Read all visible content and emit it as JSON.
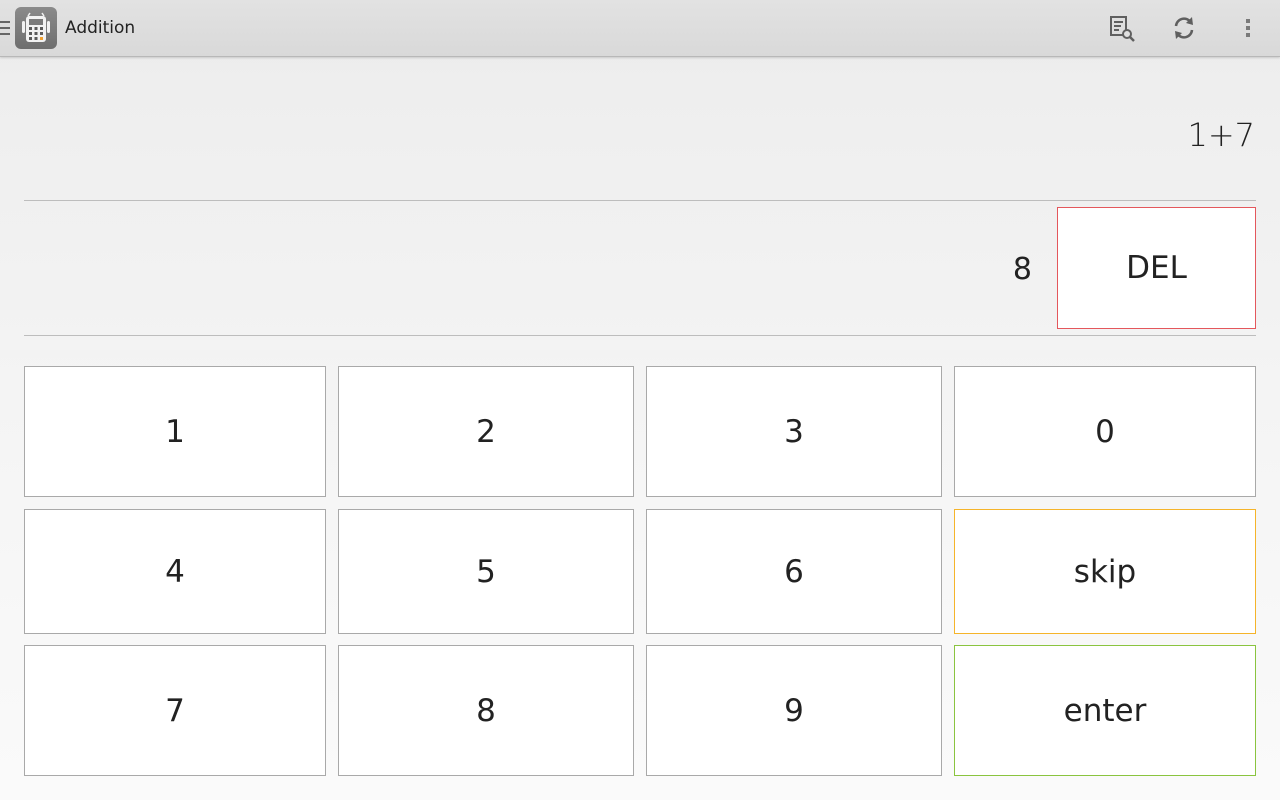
{
  "app": {
    "title": "Addition"
  },
  "actions": {
    "search_icon": "search-list-icon",
    "refresh_icon": "refresh-icon",
    "overflow_icon": "overflow-menu-icon"
  },
  "problem": {
    "expression": "1+7",
    "answer": "8"
  },
  "keypad": {
    "del": "DEL",
    "k1": "1",
    "k2": "2",
    "k3": "3",
    "k0": "0",
    "k4": "4",
    "k5": "5",
    "k6": "6",
    "skip": "skip",
    "k7": "7",
    "k8": "8",
    "k9": "9",
    "enter": "enter"
  },
  "colors": {
    "del_border": "#e4575c",
    "skip_border": "#f5b42a",
    "enter_border": "#8ac43f",
    "key_border": "#a9a9a9"
  }
}
